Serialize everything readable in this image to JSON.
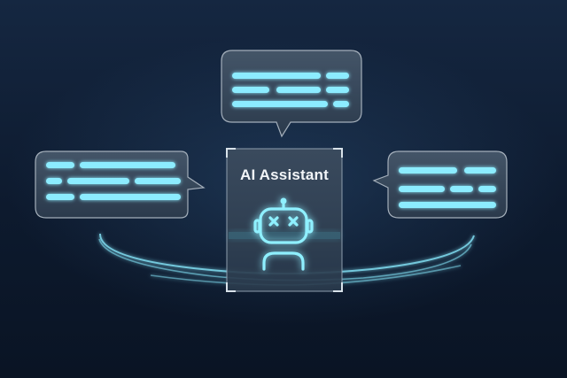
{
  "assistant": {
    "title": "AI Assistant",
    "icon": "robot-icon"
  },
  "colors": {
    "background": "#0e1a2d",
    "glow": "#5ee7ff",
    "line": "#9ef2ff",
    "bubble_fill": "#3a4a5c"
  }
}
